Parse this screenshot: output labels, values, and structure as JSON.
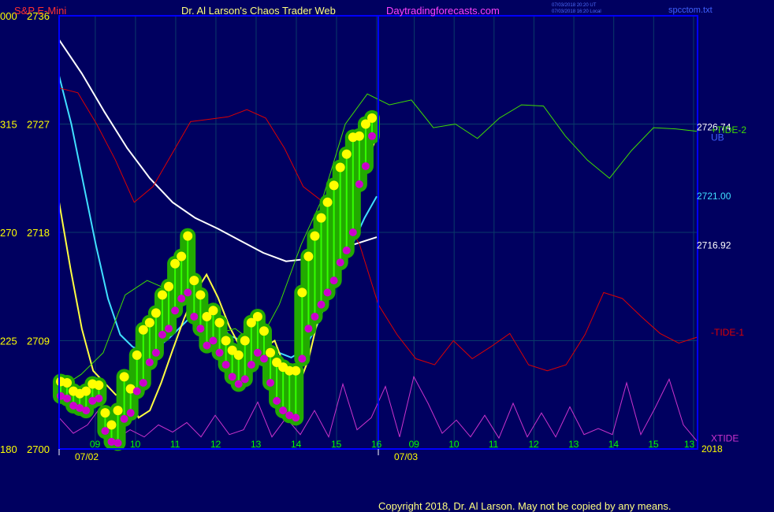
{
  "header": {
    "symbol": "S&P E-Mini",
    "title": "Dr. Al Larson's Chaos Trader Web",
    "site": "Daytradingforecasts.com",
    "stamp1": "07/03/2018 20:20 UT",
    "stamp2": "07/03/2018 16:20 Local",
    "file": "spcctom.txt"
  },
  "footer": {
    "copyright": "Copyright 2018, Dr. Al Larson. May not be copied by any means."
  },
  "colors": {
    "background": "#000060",
    "frame": "#0000ff",
    "grid": "#0a3a6a",
    "price_label": "#ffff00",
    "time_label": "#00ff00",
    "white_ma": "#ffffff",
    "cyan_ma": "#40e0ff",
    "yellow_ma": "#ffff40",
    "red_tide": "#dd0000",
    "green_tide": "#40dd00",
    "xtide": "#cc33cc",
    "bar_glow": "#22aa00",
    "bar_high": "#ffff00",
    "bar_low": "#cc00cc",
    "symbol_color": "#ff3030",
    "title_color": "#ffff80",
    "site_color": "#ff40ff",
    "file_color": "#4060ff"
  },
  "chart_data": {
    "type": "line",
    "title": "S&P E-Mini",
    "xlabel": "",
    "ylabel": "",
    "ylim": [
      2700,
      2736
    ],
    "xlim": [
      8.0,
      17.0
    ],
    "y_ticks": [
      {
        "left": "000",
        "price": "2736",
        "value": 2736
      },
      {
        "left": "315",
        "price": "2727",
        "value": 2727
      },
      {
        "left": "270",
        "price": "2718",
        "value": 2718
      },
      {
        "left": "225",
        "price": "2709",
        "value": 2709
      },
      {
        "left": "180",
        "price": "2700",
        "value": 2700
      }
    ],
    "x_ticks": [
      {
        "label": "09",
        "t": 8.9
      },
      {
        "label": "10",
        "t": 9.9
      },
      {
        "label": "11",
        "t": 10.9
      },
      {
        "label": "12",
        "t": 11.9
      },
      {
        "label": "13",
        "t": 12.9
      },
      {
        "label": "14",
        "t": 13.9
      },
      {
        "label": "15",
        "t": 14.9
      },
      {
        "label": "16",
        "t": 15.9
      },
      {
        "label": "09",
        "t": 8.9,
        "day": 2
      },
      {
        "label": "10",
        "t": 9.9,
        "day": 2
      },
      {
        "label": "11",
        "t": 10.9,
        "day": 2
      },
      {
        "label": "12",
        "t": 11.9,
        "day": 2
      },
      {
        "label": "13",
        "t": 12.9,
        "day": 2
      },
      {
        "label": "14",
        "t": 13.9,
        "day": 2
      },
      {
        "label": "15",
        "t": 14.9,
        "day": 2
      },
      {
        "label": "13",
        "t": 15.8,
        "day": 2
      }
    ],
    "dates": [
      "07/02",
      "07/03"
    ],
    "right_labels": [
      {
        "text": "2726.74",
        "value": 2726.74,
        "color": "#ffffff"
      },
      {
        "text": "+TIDE-2",
        "value": 2726.5,
        "color": "#40dd00"
      },
      {
        "text": "UB",
        "value": 2725.9,
        "color": "#4060ff"
      },
      {
        "text": "2721.00",
        "value": 2721.0,
        "color": "#40e0ff"
      },
      {
        "text": "2716.92",
        "value": 2716.92,
        "color": "#ffffff"
      },
      {
        "text": "-TIDE-1",
        "value": 2709.7,
        "color": "#dd0000"
      },
      {
        "text": "XTIDE",
        "value": 2700.9,
        "color": "#cc33cc"
      },
      {
        "text": "2018",
        "value": 2700.0,
        "color": "#ffff00"
      }
    ],
    "series": [
      {
        "key": "bars",
        "style": "bars",
        "points": [
          [
            8.0,
            2705.6,
            2704.4
          ],
          [
            8.1,
            2705.5,
            2704.2
          ],
          [
            8.2,
            2704.8,
            2703.6
          ],
          [
            8.3,
            2704.6,
            2703.4
          ],
          [
            8.4,
            2704.8,
            2703.2
          ],
          [
            8.5,
            2705.4,
            2704.0
          ],
          [
            8.6,
            2705.3,
            2704.2
          ],
          [
            8.7,
            2703.0,
            2701.5
          ],
          [
            8.8,
            2702.0,
            2700.6
          ],
          [
            8.9,
            2703.2,
            2700.5
          ],
          [
            9.0,
            2706.0,
            2702.5
          ],
          [
            9.1,
            2705.0,
            2703.0
          ],
          [
            9.2,
            2707.8,
            2704.8
          ],
          [
            9.3,
            2709.9,
            2705.5
          ],
          [
            9.4,
            2710.5,
            2707.2
          ],
          [
            9.5,
            2711.3,
            2708.0
          ],
          [
            9.6,
            2712.8,
            2709.5
          ],
          [
            9.7,
            2713.5,
            2710.0
          ],
          [
            9.8,
            2715.4,
            2711.5
          ],
          [
            9.9,
            2716.0,
            2712.5
          ],
          [
            10.0,
            2717.7,
            2713.0
          ],
          [
            10.1,
            2714.0,
            2711.0
          ],
          [
            10.2,
            2712.8,
            2710.0
          ],
          [
            10.3,
            2711.0,
            2708.6
          ],
          [
            10.4,
            2711.5,
            2709.0
          ],
          [
            10.5,
            2710.5,
            2708.0
          ],
          [
            10.6,
            2709.0,
            2707.0
          ],
          [
            10.7,
            2708.2,
            2706.0
          ],
          [
            10.8,
            2707.8,
            2705.4
          ],
          [
            10.9,
            2709.0,
            2705.8
          ],
          [
            11.0,
            2710.5,
            2707.0
          ],
          [
            11.1,
            2711.0,
            2708.0
          ],
          [
            11.2,
            2709.8,
            2707.5
          ],
          [
            11.3,
            2708.0,
            2705.5
          ],
          [
            11.4,
            2707.2,
            2704.0
          ],
          [
            11.5,
            2706.8,
            2703.2
          ],
          [
            11.6,
            2706.5,
            2702.8
          ],
          [
            11.7,
            2706.5,
            2702.6
          ],
          [
            11.8,
            2713.0,
            2707.5
          ],
          [
            11.9,
            2716.0,
            2710.0
          ],
          [
            12.0,
            2717.7,
            2711.0
          ],
          [
            12.1,
            2719.2,
            2712.0
          ],
          [
            12.2,
            2720.5,
            2713.0
          ],
          [
            12.3,
            2721.9,
            2714.0
          ],
          [
            12.4,
            2723.4,
            2715.5
          ],
          [
            12.5,
            2724.5,
            2716.5
          ],
          [
            12.6,
            2725.9,
            2718.0
          ],
          [
            12.7,
            2726.0,
            2722.0
          ],
          [
            12.8,
            2727.0,
            2723.5
          ],
          [
            12.9,
            2727.5,
            2726.0
          ]
        ]
      },
      {
        "key": "white_ma",
        "style": "line",
        "color": "#ffffff",
        "points": [
          [
            8.0,
            2734.0
          ],
          [
            8.4,
            2731.2
          ],
          [
            8.8,
            2728.0
          ],
          [
            9.2,
            2725.0
          ],
          [
            9.6,
            2722.5
          ],
          [
            10.0,
            2720.5
          ],
          [
            10.4,
            2719.2
          ],
          [
            10.8,
            2718.3
          ],
          [
            11.2,
            2717.3
          ],
          [
            11.6,
            2716.3
          ],
          [
            11.9,
            2715.6
          ],
          [
            12.2,
            2715.8
          ],
          [
            12.5,
            2716.2
          ],
          [
            12.8,
            2717.0
          ],
          [
            13.0,
            2717.6
          ]
        ]
      },
      {
        "key": "cyan_ma",
        "style": "line",
        "color": "#40e0ff",
        "points": [
          [
            8.0,
            2731.0
          ],
          [
            8.2,
            2727.0
          ],
          [
            8.4,
            2722.0
          ],
          [
            8.6,
            2717.0
          ],
          [
            8.8,
            2712.5
          ],
          [
            9.0,
            2709.5
          ],
          [
            9.2,
            2708.5
          ],
          [
            9.4,
            2708.0
          ],
          [
            9.6,
            2708.4
          ],
          [
            9.8,
            2709.2
          ],
          [
            10.0,
            2710.2
          ],
          [
            10.2,
            2711.2
          ],
          [
            10.4,
            2711.2
          ],
          [
            10.6,
            2710.4
          ],
          [
            10.8,
            2709.4
          ],
          [
            11.0,
            2709.0
          ],
          [
            11.2,
            2708.6
          ],
          [
            11.4,
            2708.4
          ],
          [
            11.6,
            2708.0
          ],
          [
            11.8,
            2707.6
          ],
          [
            12.0,
            2708.2
          ],
          [
            12.2,
            2710.0
          ],
          [
            12.4,
            2712.5
          ],
          [
            12.6,
            2715.0
          ],
          [
            12.8,
            2717.0
          ],
          [
            13.0,
            2719.2
          ],
          [
            13.2,
            2721.0
          ]
        ]
      },
      {
        "key": "yellow_ma",
        "style": "line",
        "color": "#ffff40",
        "points": [
          [
            8.0,
            2720.5
          ],
          [
            8.05,
            2715.0
          ],
          [
            8.1,
            2710.0
          ],
          [
            8.15,
            2706.5
          ],
          [
            8.2,
            2705.5
          ],
          [
            8.4,
            2704.5
          ],
          [
            8.6,
            2704.6
          ],
          [
            8.8,
            2702.6
          ],
          [
            9.0,
            2703.2
          ],
          [
            9.2,
            2705.5
          ],
          [
            9.4,
            2708.2
          ],
          [
            9.6,
            2710.8
          ],
          [
            9.8,
            2713.0
          ],
          [
            10.0,
            2714.5
          ],
          [
            10.2,
            2712.6
          ],
          [
            10.4,
            2710.2
          ],
          [
            10.6,
            2708.4
          ],
          [
            10.8,
            2707.2
          ],
          [
            11.0,
            2708.4
          ],
          [
            11.2,
            2709.0
          ],
          [
            11.4,
            2706.5
          ],
          [
            11.6,
            2705.0
          ],
          [
            11.8,
            2707.5
          ],
          [
            12.0,
            2711.5
          ],
          [
            12.2,
            2715.5
          ],
          [
            12.4,
            2718.5
          ],
          [
            12.6,
            2721.0
          ],
          [
            12.8,
            2723.5
          ],
          [
            13.0,
            2726.0
          ]
        ]
      },
      {
        "key": "green_tide",
        "style": "line",
        "color": "#40dd00",
        "points": [
          [
            8.0,
            2705.0
          ],
          [
            8.4,
            2706.2
          ],
          [
            8.8,
            2708.0
          ],
          [
            9.2,
            2712.8
          ],
          [
            9.6,
            2714.0
          ],
          [
            10.0,
            2713.2
          ],
          [
            10.4,
            2712.0
          ],
          [
            10.8,
            2709.5
          ],
          [
            11.2,
            2710.0
          ],
          [
            11.6,
            2708.6
          ],
          [
            12.0,
            2712.0
          ],
          [
            12.4,
            2717.0
          ],
          [
            12.8,
            2721.0
          ],
          [
            12.95,
            2727.0
          ],
          [
            13.2,
            2729.5
          ],
          [
            13.4,
            2728.6
          ],
          [
            13.6,
            2729.0
          ],
          [
            13.9,
            2726.7
          ],
          [
            14.3,
            2727.0
          ],
          [
            14.6,
            2725.8
          ],
          [
            14.9,
            2727.5
          ],
          [
            15.2,
            2728.6
          ],
          [
            15.5,
            2728.5
          ],
          [
            15.8,
            2726.0
          ],
          [
            16.0,
            2724.0
          ],
          [
            16.2,
            2722.5
          ],
          [
            16.4,
            2724.8
          ],
          [
            16.6,
            2726.7
          ],
          [
            16.8,
            2726.6
          ],
          [
            17.0,
            2726.4
          ]
        ]
      },
      {
        "key": "red_tide",
        "style": "line",
        "color": "#dd0000",
        "points": [
          [
            8.0,
            2730.0
          ],
          [
            8.3,
            2729.6
          ],
          [
            8.6,
            2727.0
          ],
          [
            8.9,
            2724.0
          ],
          [
            9.2,
            2720.5
          ],
          [
            9.5,
            2721.8
          ],
          [
            9.8,
            2724.5
          ],
          [
            10.1,
            2727.2
          ],
          [
            10.4,
            2727.4
          ],
          [
            10.7,
            2727.6
          ],
          [
            11.0,
            2728.2
          ],
          [
            11.3,
            2727.5
          ],
          [
            11.6,
            2725.0
          ],
          [
            11.9,
            2721.8
          ],
          [
            12.2,
            2720.6
          ],
          [
            12.5,
            2719.8
          ],
          [
            12.7,
            2717.0
          ],
          [
            12.9,
            2712.0
          ],
          [
            13.0,
            2709.5
          ],
          [
            13.3,
            2707.5
          ],
          [
            13.6,
            2707.0
          ],
          [
            13.9,
            2709.0
          ],
          [
            14.2,
            2707.5
          ],
          [
            14.5,
            2708.5
          ],
          [
            14.8,
            2709.6
          ],
          [
            15.1,
            2707.0
          ],
          [
            15.4,
            2706.5
          ],
          [
            15.7,
            2707.0
          ],
          [
            16.0,
            2709.5
          ],
          [
            16.2,
            2713.0
          ],
          [
            16.3,
            2712.5
          ],
          [
            16.4,
            2711.0
          ],
          [
            16.6,
            2709.6
          ],
          [
            16.8,
            2708.8
          ],
          [
            17.0,
            2709.3
          ]
        ]
      },
      {
        "key": "xtide",
        "style": "line",
        "color": "#cc33cc",
        "points": [
          [
            8.0,
            2702.6
          ],
          [
            8.2,
            2701.3
          ],
          [
            8.4,
            2702.0
          ],
          [
            8.6,
            2703.6
          ],
          [
            8.8,
            2700.8
          ],
          [
            9.0,
            2701.6
          ],
          [
            9.2,
            2701.0
          ],
          [
            9.4,
            2702.0
          ],
          [
            9.6,
            2701.4
          ],
          [
            9.8,
            2702.2
          ],
          [
            10.0,
            2701.0
          ],
          [
            10.2,
            2702.8
          ],
          [
            10.4,
            2701.2
          ],
          [
            10.6,
            2701.6
          ],
          [
            10.8,
            2703.9
          ],
          [
            11.0,
            2701.0
          ],
          [
            11.2,
            2702.6
          ],
          [
            11.4,
            2701.2
          ],
          [
            11.6,
            2703.2
          ],
          [
            11.8,
            2701.0
          ],
          [
            12.0,
            2705.4
          ],
          [
            12.2,
            2701.6
          ],
          [
            12.4,
            2702.6
          ],
          [
            12.6,
            2705.2
          ],
          [
            12.8,
            2701.0
          ],
          [
            13.0,
            2706.0
          ],
          [
            13.2,
            2703.8
          ],
          [
            13.4,
            2701.3
          ],
          [
            13.6,
            2702.4
          ],
          [
            13.8,
            2701.0
          ],
          [
            14.0,
            2702.8
          ],
          [
            14.2,
            2700.9
          ],
          [
            14.4,
            2703.8
          ],
          [
            14.6,
            2701.0
          ],
          [
            14.8,
            2703.0
          ],
          [
            15.0,
            2701.0
          ],
          [
            15.2,
            2703.5
          ],
          [
            15.4,
            2701.2
          ],
          [
            15.6,
            2701.7
          ],
          [
            15.8,
            2701.2
          ],
          [
            16.0,
            2705.5
          ],
          [
            16.2,
            2701.2
          ],
          [
            16.4,
            2703.4
          ],
          [
            16.6,
            2705.8
          ],
          [
            16.8,
            2702.0
          ],
          [
            17.0,
            2700.6
          ]
        ]
      }
    ]
  }
}
